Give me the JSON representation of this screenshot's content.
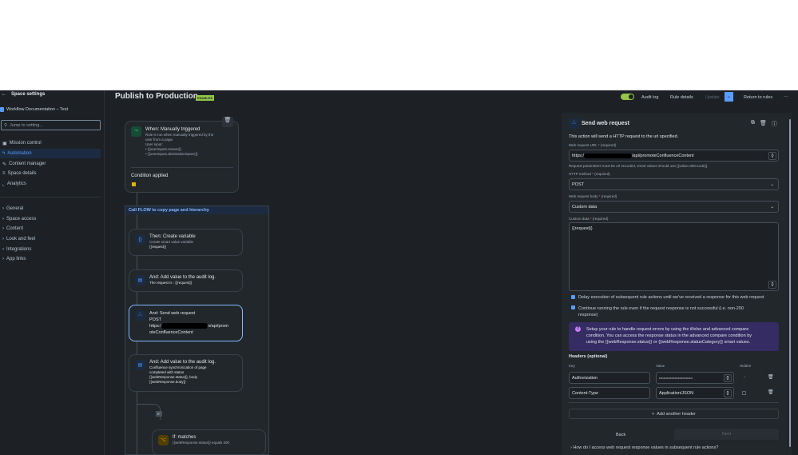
{
  "sidebar": {
    "back_label": "Space settings",
    "space_name": "Workflow Documentation – Test",
    "search_placeholder": "Jump to setting...",
    "items": [
      {
        "label": "Mission control",
        "icon": "board-icon"
      },
      {
        "label": "Automation",
        "icon": "lightning-icon"
      },
      {
        "label": "Content manager",
        "icon": "content-icon"
      },
      {
        "label": "Space details",
        "icon": "sliders-icon"
      },
      {
        "label": "Analytics",
        "icon": "chart-icon"
      }
    ],
    "groups": [
      "General",
      "Space access",
      "Content",
      "Look and feel",
      "Integrations",
      "App links"
    ]
  },
  "header": {
    "title": "Publish to Production",
    "badge": "ENABLED",
    "audit_log": "Audit log",
    "rule_details": "Rule details",
    "update": "Update",
    "return": "Return to rules",
    "more": "···"
  },
  "flow": {
    "trigger": {
      "title": "When: Manually triggered",
      "desc1": "Rule is run when manually triggered by the",
      "desc2": "user from a page.",
      "desc3": "User input:",
      "inputs": [
        "{{userInputs.reason}}",
        "{{userInputs.destinationSpace}}"
      ],
      "condition": "Condition applied"
    },
    "branch_label": "Call FLOW to copy page and hierarchy",
    "steps": [
      {
        "title": "Then: Create variable",
        "lines": [
          "Create smart value variable",
          "{{request}}"
        ]
      },
      {
        "title": "And: Add value to the audit log.",
        "lines": [
          "The request is : {{request}}"
        ]
      },
      {
        "title": "And: Send web request",
        "lines": [
          "POST",
          "https:/",
          "n/api/prom",
          "oteConfluenceContent"
        ]
      },
      {
        "title": "And: Add value to the audit log.",
        "lines": [
          "Confluence synchronization of page",
          "completed with status",
          "{{webResponse.status}}, body",
          "{{webResponse.body}}"
        ]
      }
    ],
    "if_badge": "IF",
    "if_card": {
      "title": "If: matches",
      "desc": "{{webResponse.status}} equals 200"
    }
  },
  "panel": {
    "title": "Send web request",
    "description": "This action will send a HTTP request to the url specified.",
    "url_label": "Web request URL",
    "required": "(required)",
    "url_prefix": "https:/",
    "url_suffix": "/api/promoteConfluenceContent",
    "url_hint": "Request parameters must be url encoded, smart values should use {{value.urlEncode}}.",
    "method_label": "HTTP method",
    "method": "POST",
    "body_label": "Web request body",
    "body": "Custom data",
    "custom_label": "Custom data",
    "custom_value": "{{request}}",
    "brace": "{}",
    "delay": "Delay execution of subsequent rule actions until we've received a response for this web request",
    "continue1": "Continue running the rule even if the request response is not successful (i.e. non-200",
    "continue2": "response)",
    "info1": "Setup your rule to handle request errors by using the if/else and advanced compare",
    "info2": "condition. You can access the response status in the advanced compare condition by",
    "info3": "using the {{webResponse.status}} or {{webResponse.statusCategory}} smart values.",
    "headers_title": "Headers (optional)",
    "col_key": "Key",
    "col_value": "Value",
    "col_hidden": "Hidden",
    "headers": [
      {
        "key": "Authorization",
        "value": "••••••••••••••••••••••••••••••"
      },
      {
        "key": "Content-Type",
        "value": "Application/JSON"
      }
    ],
    "add_header": "Add another header",
    "back": "Back",
    "next": "Next",
    "faq": "How do I access web request response values in subsequent rule actions?"
  },
  "colors": {
    "accent": "#579dff",
    "enabled": "#94c748",
    "info_bg": "#352c63"
  }
}
